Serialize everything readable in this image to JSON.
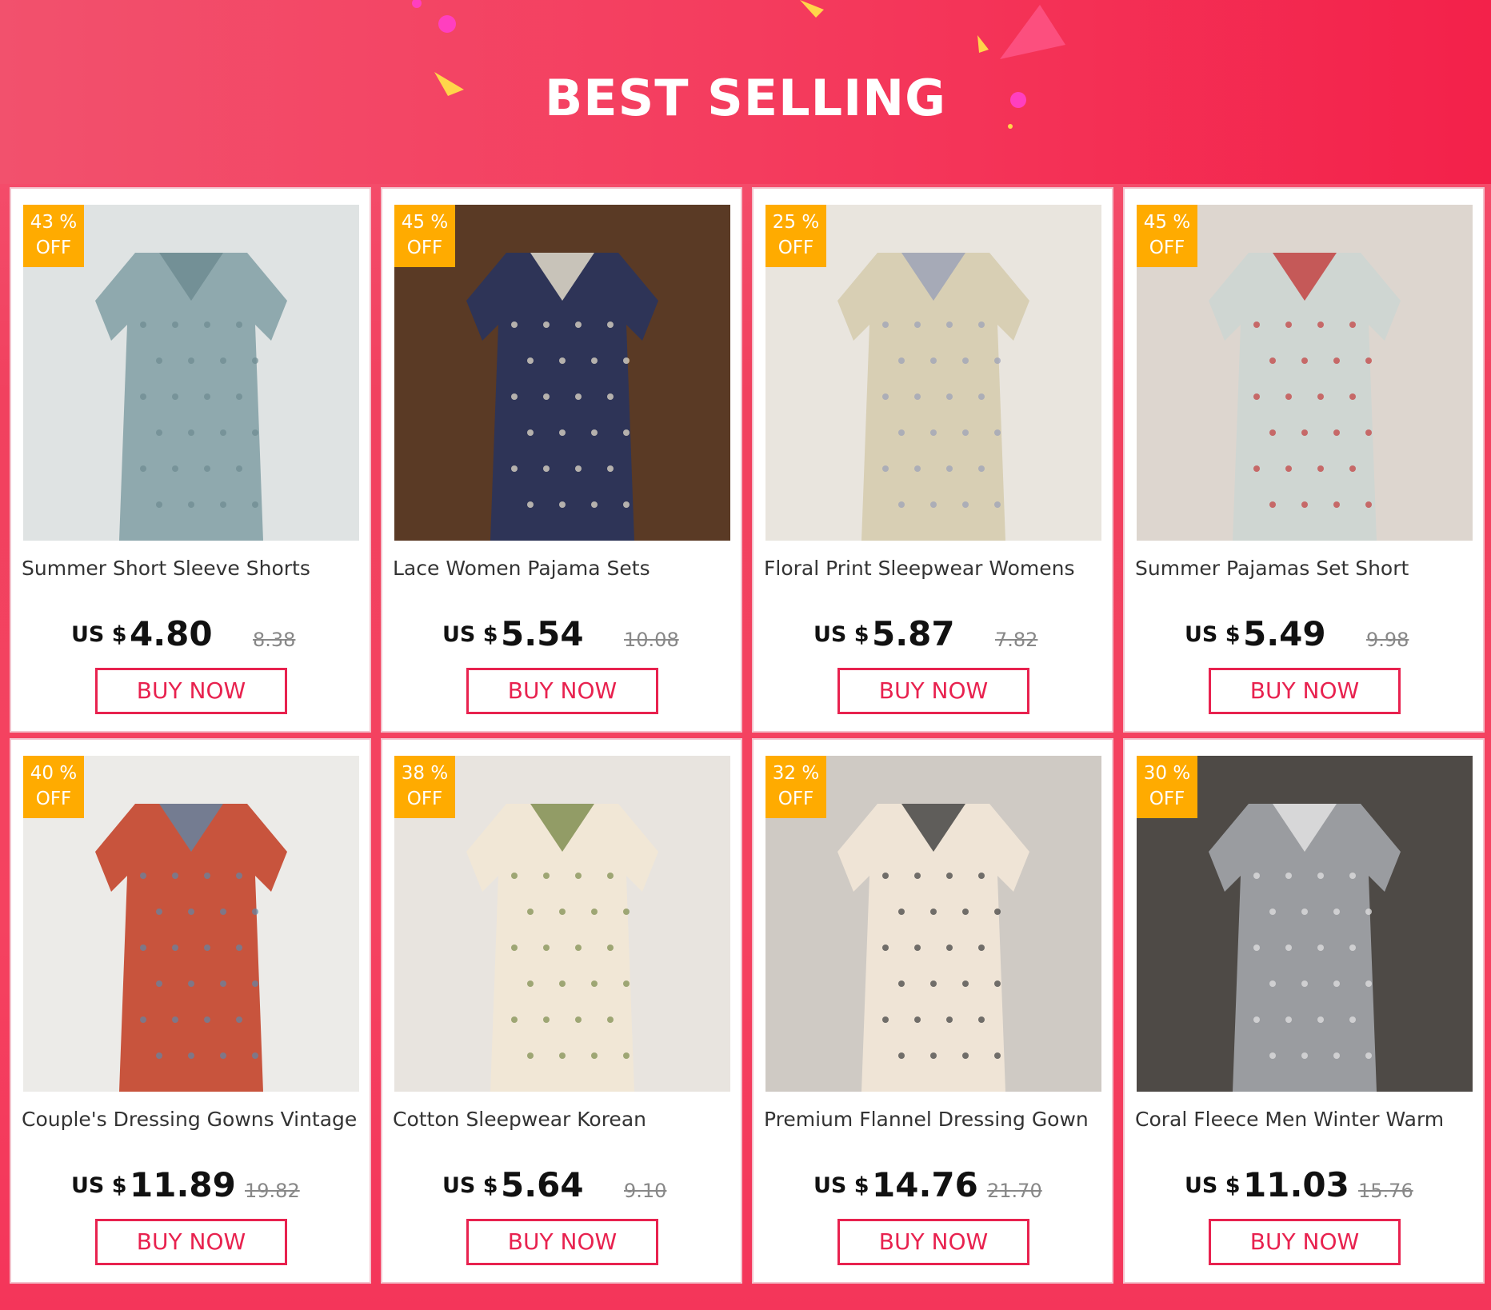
{
  "banner": {
    "title": "BEST SELLING",
    "colors": {
      "start": "#f2516d",
      "end": "#f3214a",
      "text": "#ffffff"
    }
  },
  "colors": {
    "badge": "#ffab00",
    "button": "#e8224f",
    "page": "#f4415f"
  },
  "products": [
    {
      "discount": "43 %",
      "off": "OFF",
      "title": "Summer Short Sleeve Shorts",
      "currency": "US $",
      "price": "4.80",
      "old_price": "8.38",
      "button": "BUY NOW",
      "image": "striped-pajama-photo",
      "bg": "#dfe3e3",
      "main": "#8fa9ae",
      "accent": "#6c8a90"
    },
    {
      "discount": "45 %",
      "off": "OFF",
      "title": "Lace Women Pajama Sets",
      "currency": "US $",
      "price": "5.54",
      "old_price": "10.08",
      "button": "BUY NOW",
      "image": "plaid-lace-pajama-photo",
      "bg": "#5a3a25",
      "main": "#2e3457",
      "accent": "#efe7d2"
    },
    {
      "discount": "25 %",
      "off": "OFF",
      "title": "Floral Print Sleepwear Womens",
      "currency": "US $",
      "price": "5.87",
      "old_price": "7.82",
      "button": "BUY NOW",
      "image": "floral-nightgown-photo",
      "bg": "#e9e5de",
      "main": "#d8cfb4",
      "accent": "#9aa0b8"
    },
    {
      "discount": "45 %",
      "off": "OFF",
      "title": "Summer Pajamas Set Short",
      "currency": "US $",
      "price": "5.49",
      "old_price": "9.98",
      "button": "BUY NOW",
      "image": "strawberry-pajama-photo",
      "bg": "#ddd6cf",
      "main": "#cfd6d2",
      "accent": "#c23a3a"
    },
    {
      "discount": "40 %",
      "off": "OFF",
      "title": "Couple's Dressing Gowns Vintage",
      "currency": "US $",
      "price": "11.89",
      "old_price": "19.82",
      "button": "BUY NOW",
      "image": "printed-robes-photo",
      "bg": "#ecebe8",
      "main": "#c8543d",
      "accent": "#5f86a6"
    },
    {
      "discount": "38 %",
      "off": "OFF",
      "title": "Cotton Sleepwear Korean",
      "currency": "US $",
      "price": "5.64",
      "old_price": "9.10",
      "button": "BUY NOW",
      "image": "cream-pajama-photo",
      "bg": "#e8e4df",
      "main": "#f1e7d6",
      "accent": "#7a8a4a"
    },
    {
      "discount": "32 %",
      "off": "OFF",
      "title": "Premium Flannel Dressing Gown",
      "currency": "US $",
      "price": "14.76",
      "old_price": "21.70",
      "button": "BUY NOW",
      "image": "flannel-robe-photo",
      "bg": "#cfcac4",
      "main": "#efe4d6",
      "accent": "#3b3b3b"
    },
    {
      "discount": "30 %",
      "off": "OFF",
      "title": "Coral Fleece Men Winter Warm",
      "currency": "US $",
      "price": "11.03",
      "old_price": "15.76",
      "button": "BUY NOW",
      "image": "fleece-pajama-photo",
      "bg": "#4e4a46",
      "main": "#9a9ca0",
      "accent": "#e6e6e6"
    }
  ]
}
